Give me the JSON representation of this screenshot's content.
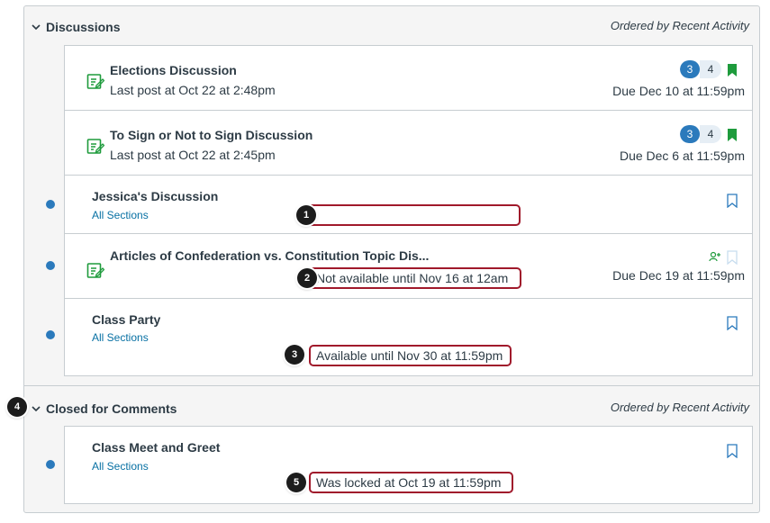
{
  "discussions": {
    "title": "Discussions",
    "order_label": "Ordered by Recent Activity",
    "items": [
      {
        "title": "Elections Discussion",
        "subtitle": "Last post at Oct 22 at 2:48pm",
        "unread": "3",
        "total": "4",
        "due": "Due Dec 10 at 11:59pm"
      },
      {
        "title": "To Sign or Not to Sign Discussion",
        "subtitle": "Last post at Oct 22 at 2:45pm",
        "unread": "3",
        "total": "4",
        "due": "Due Dec 6 at 11:59pm"
      },
      {
        "title": "Jessica's Discussion",
        "sections": "All Sections",
        "callout": ""
      },
      {
        "title": "Articles of Confederation vs. Constitution Topic Dis...",
        "callout": "Not available until Nov 16 at 12am",
        "due": "Due Dec 19 at 11:59pm"
      },
      {
        "title": "Class Party",
        "sections": "All Sections",
        "callout": "Available until Nov 30 at 11:59pm"
      }
    ]
  },
  "closed": {
    "title": "Closed for Comments",
    "order_label": "Ordered by Recent Activity",
    "items": [
      {
        "title": "Class Meet and Greet",
        "sections": "All Sections",
        "callout": "Was locked at Oct 19 at 11:59pm"
      }
    ]
  },
  "callout_numbers": [
    "1",
    "2",
    "3",
    "4",
    "5"
  ],
  "colors": {
    "accent": "#2b7abc",
    "published": "#1e9b3c",
    "callout_border": "#a0192b",
    "link": "#0770a3"
  }
}
